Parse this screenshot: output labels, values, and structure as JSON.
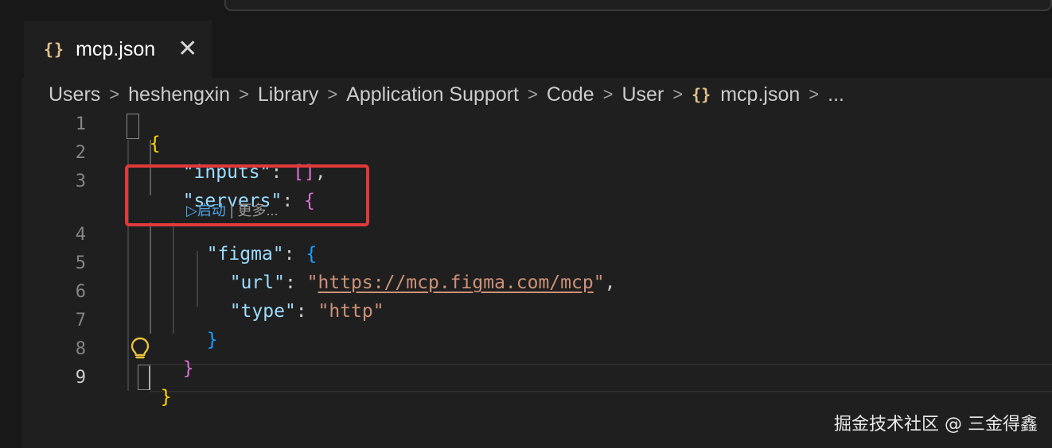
{
  "tab": {
    "icon": "{}",
    "label": "mcp.json",
    "close": "✕"
  },
  "breadcrumb": {
    "items": [
      "Users",
      "heshengxin",
      "Library",
      "Application Support",
      "Code",
      "User"
    ],
    "file_icon": "{}",
    "file": "mcp.json",
    "more": "...",
    "separator": ">"
  },
  "line_numbers": [
    "1",
    "2",
    "3",
    "4",
    "5",
    "6",
    "7",
    "8",
    "9"
  ],
  "code": {
    "l1_brace": "{",
    "l2_key": "\"inputs\"",
    "l2_colon": ": ",
    "l2_array": "[]",
    "l2_comma": ",",
    "l3_key": "\"servers\"",
    "l3_colon": ": ",
    "l3_brace": "{",
    "l4_key": "\"figma\"",
    "l4_colon": ": ",
    "l4_brace": "{",
    "l5_key": "\"url\"",
    "l5_colon": ": ",
    "l5_quote_open": "\"",
    "l5_url": "https://mcp.figma.com/mcp",
    "l5_quote_close": "\"",
    "l5_comma": ",",
    "l6_key": "\"type\"",
    "l6_colon": ": ",
    "l6_value": "\"http\"",
    "l7_brace": "}",
    "l8_brace": "}",
    "l9_brace": "}"
  },
  "codelens": {
    "run": "▷启动",
    "divider": " | ",
    "more": "更多..."
  },
  "watermark": "掘金技术社区 @ 三金得鑫",
  "colors": {
    "highlight_border": "#e0393c",
    "json_key": "#9cdcfe",
    "string": "#ce9178",
    "bracket_level1": "#ffd700",
    "bracket_level2": "#da70d6",
    "bracket_level3": "#179fff"
  },
  "icons": [
    "json-file-icon",
    "close-icon",
    "chevron-right-icon",
    "lightbulb-icon",
    "run-icon"
  ]
}
